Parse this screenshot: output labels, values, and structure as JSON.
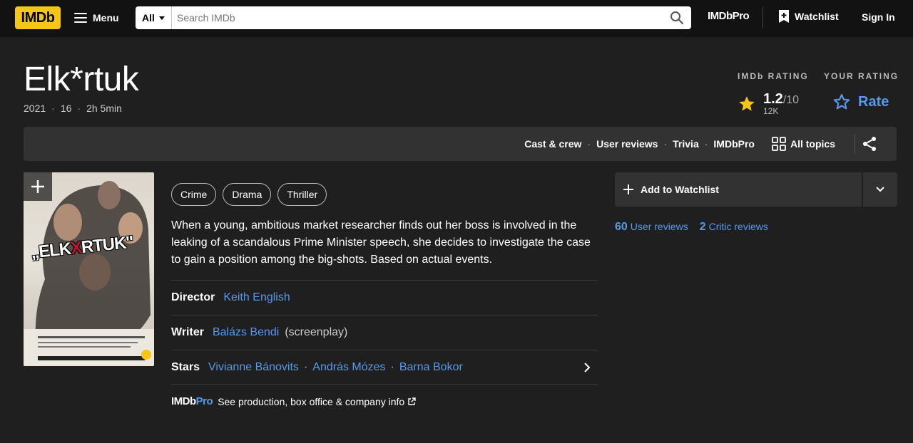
{
  "nav": {
    "logo": "IMDb",
    "menu_label": "Menu",
    "search_category": "All",
    "search_placeholder": "Search IMDb",
    "imdbpro_label": "IMDbPro",
    "watchlist_label": "Watchlist",
    "signin_label": "Sign In"
  },
  "title": {
    "name": "Elk*rtuk",
    "year": "2021",
    "certificate": "16",
    "runtime": "2h 5min"
  },
  "rating": {
    "imdb_label": "IMDb RATING",
    "value": "1.2",
    "out_of": "/10",
    "count": "12K",
    "your_label": "YOUR RATING",
    "rate_label": "Rate",
    "star_color": "#f5c518",
    "accent_color": "#5799ef"
  },
  "subnav": {
    "links": [
      "Cast & crew",
      "User reviews",
      "Trivia",
      "IMDbPro"
    ],
    "all_topics": "All topics"
  },
  "poster": {
    "title_text_a": "„ELK",
    "title_text_x": "X",
    "title_text_b": "RTUK\""
  },
  "genres": [
    "Crime",
    "Drama",
    "Thriller"
  ],
  "plot": "When a young, ambitious market researcher finds out her boss is involved in the leaking of a scandalous Prime Minister speech, she decides to investigate the case to gain a position among the big-shots. Based on actual events.",
  "credits": {
    "director_label": "Director",
    "director": "Keith English",
    "writer_label": "Writer",
    "writer": "Balázs Bendi",
    "writer_note": "(screenplay)",
    "stars_label": "Stars",
    "stars": [
      "Vivianne Bánovits",
      "András Mózes",
      "Barna Bokor"
    ]
  },
  "imdbpro_promo": {
    "logo_a": "IMDb",
    "logo_b": "Pro",
    "text": "See production, box office & company info"
  },
  "side": {
    "add_watchlist": "Add to Watchlist",
    "user_reviews_count": "60",
    "user_reviews_label": "User reviews",
    "critic_reviews_count": "2",
    "critic_reviews_label": "Critic reviews"
  }
}
